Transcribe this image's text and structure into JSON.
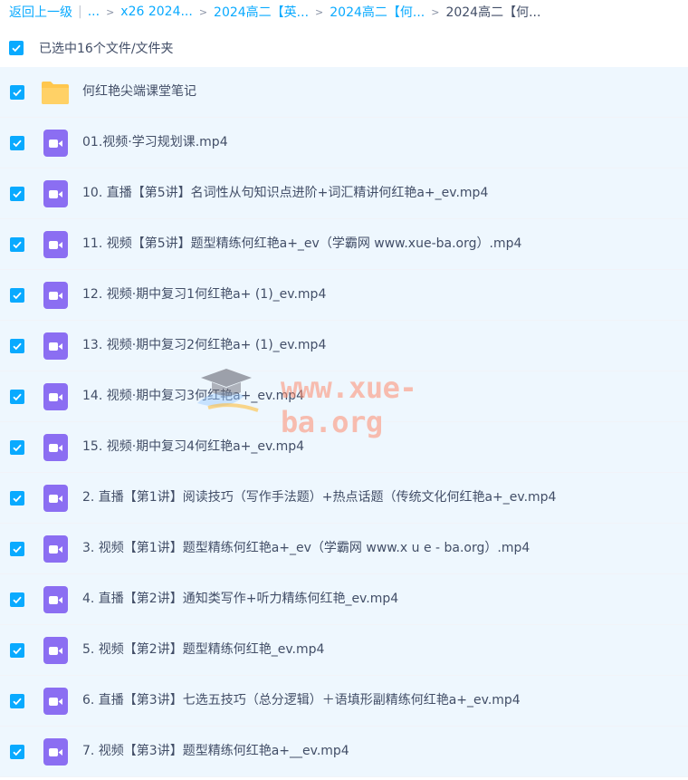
{
  "breadcrumb": {
    "back_label": "返回上一级",
    "ellipsis": "...",
    "crumbs": [
      "x26 2024...",
      "2024高二【英...",
      "2024高二【何...",
      "2024高二【何..."
    ]
  },
  "selection": {
    "label": "已选中16个文件/文件夹"
  },
  "files": [
    {
      "name": "何红艳尖端课堂笔记",
      "type": "folder"
    },
    {
      "name": "01.视频·学习规划课.mp4",
      "type": "video"
    },
    {
      "name": "10. 直播【第5讲】名词性从句知识点进阶+词汇精讲何红艳a+_ev.mp4",
      "type": "video"
    },
    {
      "name": "11. 视频【第5讲】题型精练何红艳a+_ev（学霸网 www.xue-ba.org）.mp4",
      "type": "video"
    },
    {
      "name": "12. 视频·期中复习1何红艳a+ (1)_ev.mp4",
      "type": "video"
    },
    {
      "name": "13. 视频·期中复习2何红艳a+ (1)_ev.mp4",
      "type": "video"
    },
    {
      "name": "14. 视频·期中复习3何红艳a+_ev.mp4",
      "type": "video"
    },
    {
      "name": "15. 视频·期中复习4何红艳a+_ev.mp4",
      "type": "video"
    },
    {
      "name": "2. 直播【第1讲】阅读技巧（写作手法题）+热点话题（传统文化何红艳a+_ev.mp4",
      "type": "video"
    },
    {
      "name": "3. 视频【第1讲】题型精练何红艳a+_ev（学霸网 www.x u e - ba.org）.mp4",
      "type": "video"
    },
    {
      "name": "4. 直播【第2讲】通知类写作+听力精练何红艳_ev.mp4",
      "type": "video"
    },
    {
      "name": "5. 视频【第2讲】题型精练何红艳_ev.mp4",
      "type": "video"
    },
    {
      "name": "6. 直播【第3讲】七选五技巧（总分逻辑）＋语填形副精练何红艳a+_ev.mp4",
      "type": "video"
    },
    {
      "name": "7. 视频【第3讲】题型精练何红艳a+__ev.mp4",
      "type": "video"
    }
  ],
  "watermark": {
    "text": "www.xue-ba.org"
  },
  "colors": {
    "accent": "#09aaff",
    "row_bg": "#eef7fe",
    "video_icon": "#8b6ef2",
    "folder_icon": "#ffc74d"
  }
}
